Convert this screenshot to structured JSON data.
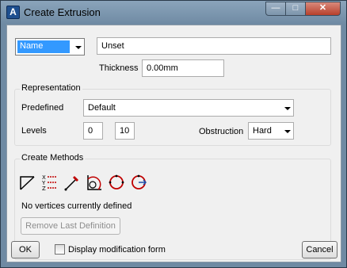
{
  "window": {
    "title": "Create Extrusion",
    "app_icon_letter": "A",
    "minimize_glyph": "—",
    "maximize_glyph": "□",
    "close_glyph": "✕"
  },
  "name_row": {
    "selector_value": "Name",
    "name_value": "Unset",
    "thickness_label": "Thickness",
    "thickness_value": "0.00mm"
  },
  "representation": {
    "group_label": "Representation",
    "predefined_label": "Predefined",
    "predefined_value": "Default",
    "levels_label": "Levels",
    "level_from": "0",
    "level_to": "10",
    "obstruction_label": "Obstruction",
    "obstruction_value": "Hard"
  },
  "create_methods": {
    "group_label": "Create Methods",
    "tools": [
      "polyline-icon",
      "xyz-coordinates-icon",
      "pick-point-icon",
      "arc-tangent-icon",
      "circle-icon",
      "circle-arrow-icon"
    ],
    "xyz_letters": [
      "X",
      "Y",
      "Z"
    ],
    "status_text": "No vertices currently defined",
    "remove_button": "Remove Last Definition"
  },
  "footer": {
    "ok_label": "OK",
    "checkbox_label": "Display modification form",
    "checkbox_checked": false,
    "cancel_label": "Cancel"
  }
}
